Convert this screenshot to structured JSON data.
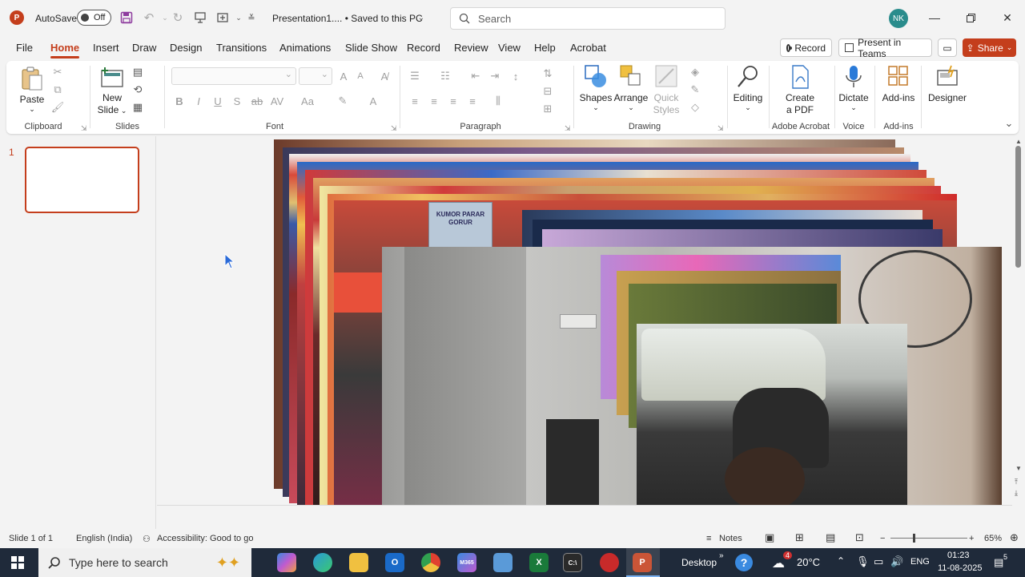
{
  "titlebar": {
    "app_badge": "P",
    "autosave_label": "AutoSave",
    "autosave_state": "Off",
    "doc_title": "Presentation1....  •  Saved to this PC",
    "search_placeholder": "Search",
    "user_initials": "NK"
  },
  "tabs": [
    "File",
    "Home",
    "Insert",
    "Draw",
    "Design",
    "Transitions",
    "Animations",
    "Slide Show",
    "Record",
    "Review",
    "View",
    "Help",
    "Acrobat"
  ],
  "tabs_active": "Home",
  "right_buttons": {
    "record": "Record",
    "present_teams": "Present in Teams",
    "share": "Share"
  },
  "ribbon": {
    "clipboard": {
      "label": "Clipboard",
      "paste": "Paste"
    },
    "slides": {
      "label": "Slides",
      "new_slide_1": "New",
      "new_slide_2": "Slide"
    },
    "font": {
      "label": "Font"
    },
    "paragraph": {
      "label": "Paragraph"
    },
    "drawing": {
      "label": "Drawing",
      "shapes": "Shapes",
      "arrange": "Arrange",
      "quick_styles_1": "Quick",
      "quick_styles_2": "Styles"
    },
    "editing": {
      "label": "Editing"
    },
    "adobe": {
      "label": "Adobe Acrobat",
      "create_pdf_1": "Create",
      "create_pdf_2": "a PDF"
    },
    "voice": {
      "label": "Voice",
      "dictate": "Dictate"
    },
    "addins": {
      "label": "Add-ins",
      "addins": "Add-ins"
    },
    "designer": {
      "designer": "Designer"
    }
  },
  "thumbnails": {
    "slide_number": "1"
  },
  "slide_photos": {
    "poster_text": "KUMOR PARAR GORUR"
  },
  "statusbar": {
    "slide_of": "Slide 1 of 1",
    "language": "English (India)",
    "accessibility": "Accessibility: Good to go",
    "notes": "Notes",
    "zoom": "65%"
  },
  "taskbar": {
    "search_placeholder": "Type here to search",
    "desktop": "Desktop",
    "weather": "20°C",
    "weather_badge": "4",
    "lang": "ENG",
    "time": "01:23",
    "date": "11-08-2025",
    "notif_count": "5"
  },
  "colors": {
    "accent": "#c43e1c",
    "taskbar": "#1f2a3a",
    "avatar": "#2a8c8c"
  }
}
